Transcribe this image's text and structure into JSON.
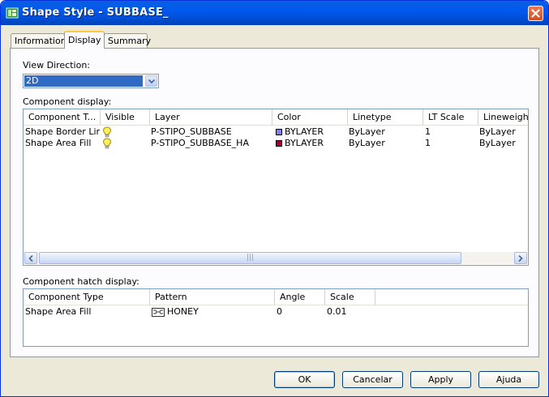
{
  "window": {
    "title": "Shape Style - SUBBASE_"
  },
  "tabs": [
    {
      "label": "Information"
    },
    {
      "label": "Display"
    },
    {
      "label": "Summary"
    }
  ],
  "view_direction": {
    "label": "View Direction:",
    "value": "2D"
  },
  "component_display": {
    "label": "Component display:",
    "columns": [
      "Component T...",
      "Visible",
      "Layer",
      "Color",
      "Linetype",
      "LT Scale",
      "Lineweight"
    ],
    "rows": [
      {
        "component": "Shape Border Line",
        "visible_icon": "lightbulb-on-icon",
        "layer": "P-STIPO_SUBBASE",
        "color_name": "BYLAYER",
        "color_hex": "#8080f0",
        "linetype": "ByLayer",
        "lt_scale": "1",
        "lineweight": "ByLayer"
      },
      {
        "component": "Shape Area Fill",
        "visible_icon": "lightbulb-on-icon",
        "layer": "P-STIPO_SUBBASE_HA",
        "color_name": "BYLAYER",
        "color_hex": "#a0003c",
        "linetype": "ByLayer",
        "lt_scale": "1",
        "lineweight": "ByLayer"
      }
    ]
  },
  "hatch_display": {
    "label": "Component hatch display:",
    "columns": [
      "Component Type",
      "Pattern",
      "Angle",
      "Scale"
    ],
    "rows": [
      {
        "component": "Shape Area Fill",
        "pattern_icon": "hatch-pattern-icon",
        "pattern": "HONEY",
        "angle": "0",
        "scale": "0.01"
      }
    ]
  },
  "buttons": {
    "ok": "OK",
    "cancel": "Cancelar",
    "apply": "Apply",
    "help": "Ajuda"
  },
  "colors": {
    "titlebar": "#0058ee",
    "selection": "#316ac5",
    "dialog_bg": "#ece9d8"
  }
}
